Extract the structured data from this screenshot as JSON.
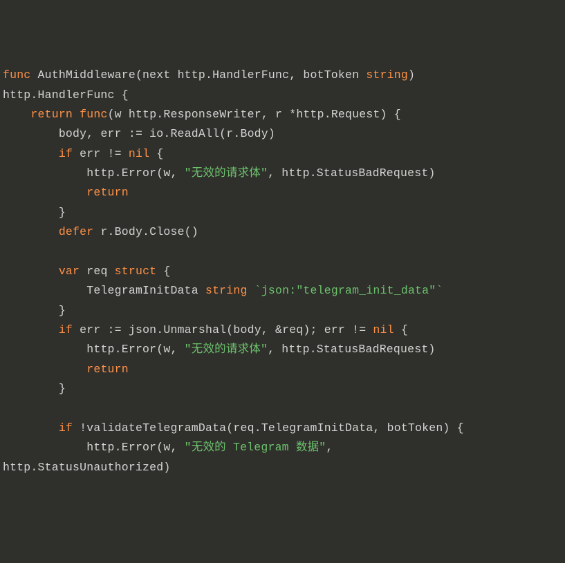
{
  "code": {
    "l1": {
      "kw_func": "func",
      "name": "AuthMiddleware(next http.HandlerFunc, botToken ",
      "kw_string": "string",
      "close": ")"
    },
    "l2": {
      "txt": "http.HandlerFunc {"
    },
    "l3": {
      "indent": "    ",
      "kw_return": "return",
      "sp": " ",
      "kw_func": "func",
      "rest": "(w http.ResponseWriter, r *http.Request) {"
    },
    "l4": {
      "indent": "        ",
      "txt": "body, err := io.ReadAll(r.Body)"
    },
    "l5": {
      "indent": "        ",
      "kw_if": "if",
      "mid": " err != ",
      "kw_nil": "nil",
      "rest": " {"
    },
    "l6": {
      "indent": "            ",
      "pre": "http.Error(w, ",
      "str": "\"无效的请求体\"",
      "post": ", http.StatusBadRequest)"
    },
    "l7": {
      "indent": "            ",
      "kw_return": "return"
    },
    "l8": {
      "indent": "        ",
      "txt": "}"
    },
    "l9": {
      "indent": "        ",
      "kw_defer": "defer",
      "rest": " r.Body.Close()"
    },
    "l10": "",
    "l11": {
      "indent": "        ",
      "kw_var": "var",
      "mid": " req ",
      "kw_struct": "struct",
      "rest": " {"
    },
    "l12": {
      "indent": "            ",
      "pre": "TelegramInitData ",
      "kw_string": "string",
      "sp": " ",
      "str": "`json:\"telegram_init_data\"`"
    },
    "l13": {
      "indent": "        ",
      "txt": "}"
    },
    "l14": {
      "indent": "        ",
      "kw_if": "if",
      "mid": " err := json.Unmarshal(body, &req); err != ",
      "kw_nil": "nil",
      "rest": " {"
    },
    "l15": {
      "indent": "            ",
      "pre": "http.Error(w, ",
      "str": "\"无效的请求体\"",
      "post": ", http.StatusBadRequest)"
    },
    "l16": {
      "indent": "            ",
      "kw_return": "return"
    },
    "l17": {
      "indent": "        ",
      "txt": "}"
    },
    "l18": "",
    "l19": {
      "indent": "        ",
      "kw_if": "if",
      "rest": " !validateTelegramData(req.TelegramInitData, botToken) {"
    },
    "l20": {
      "indent": "            ",
      "pre": "http.Error(w, ",
      "str": "\"无效的 Telegram 数据\"",
      "post": ","
    },
    "l21": {
      "txt": "http.StatusUnauthorized)"
    }
  }
}
